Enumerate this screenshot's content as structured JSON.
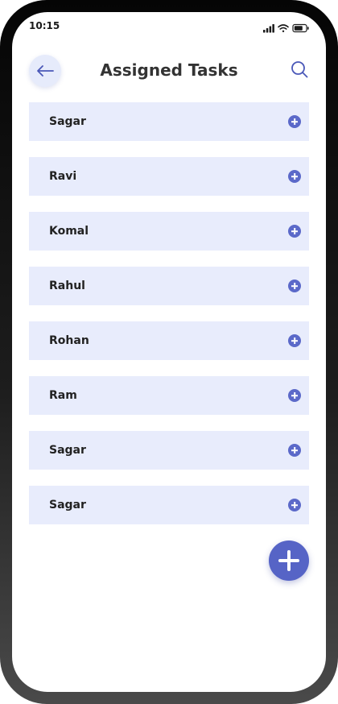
{
  "status_bar": {
    "time": "10:15",
    "icons": [
      "signal-icon",
      "wifi-icon",
      "battery-icon"
    ]
  },
  "header": {
    "title": "Assigned Tasks",
    "back_icon": "arrow-left-icon",
    "search_icon": "search-icon"
  },
  "tasks": [
    {
      "name": "Sagar"
    },
    {
      "name": "Ravi"
    },
    {
      "name": "Komal"
    },
    {
      "name": "Rahul"
    },
    {
      "name": "Rohan"
    },
    {
      "name": "Ram"
    },
    {
      "name": "Sagar"
    },
    {
      "name": "Sagar"
    }
  ],
  "fab": {
    "icon": "plus-icon"
  },
  "colors": {
    "accent": "#5664c6",
    "row_background": "#e8ecfc",
    "title_text": "#333333"
  }
}
